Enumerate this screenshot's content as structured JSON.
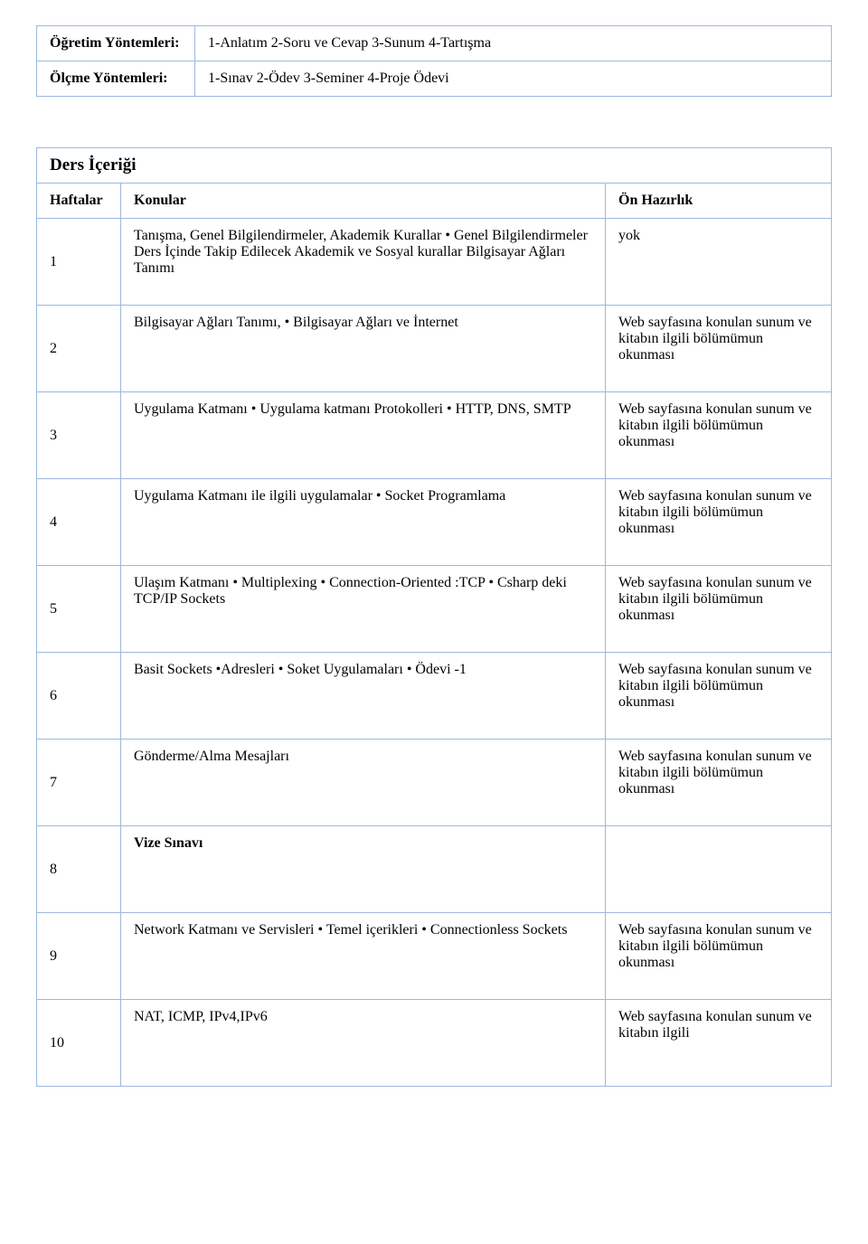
{
  "methods": {
    "teaching_label": "Öğretim Yöntemleri:",
    "teaching_value": "1-Anlatım   2-Soru ve Cevap  3-Sunum  4-Tartışma",
    "assessment_label": "Ölçme Yöntemleri:",
    "assessment_value": "1-Sınav   2-Ödev   3-Seminer   4-Proje Ödevi"
  },
  "content_title": "Ders İçeriği",
  "schedule_header": {
    "weeks": "Haftalar",
    "topics": "Konular",
    "prep": "Ön Hazırlık"
  },
  "rows": [
    {
      "week": "1",
      "topic": "Tanışma, Genel Bilgilendirmeler, Akademik Kurallar • Genel Bilgilendirmeler Ders İçinde Takip Edilecek Akademik ve Sosyal kurallar Bilgisayar Ağları Tanımı",
      "prep": "yok"
    },
    {
      "week": "2",
      "topic": "Bilgisayar Ağları Tanımı, • Bilgisayar Ağları ve İnternet",
      "prep": "Web sayfasına konulan sunum ve kitabın ilgili bölümümun okunması"
    },
    {
      "week": "3",
      "topic": "Uygulama Katmanı • Uygulama katmanı Protokolleri • HTTP, DNS, SMTP",
      "prep": "Web sayfasına konulan sunum ve kitabın ilgili bölümümun okunması"
    },
    {
      "week": "4",
      "topic": "Uygulama Katmanı ile ilgili uygulamalar • Socket Programlama",
      "prep": "Web sayfasına konulan sunum ve kitabın ilgili bölümümun okunması"
    },
    {
      "week": "5",
      "topic": "Ulaşım Katmanı • Multiplexing • Connection-Oriented :TCP • Csharp deki TCP/IP Sockets",
      "prep": "Web sayfasına konulan sunum ve kitabın ilgili bölümümun okunması"
    },
    {
      "week": "6",
      "topic": "Basit Sockets •Adresleri • Soket Uygulamaları • Ödevi -1",
      "prep": "Web sayfasına konulan sunum ve kitabın ilgili bölümümun okunması"
    },
    {
      "week": "7",
      "topic": "Gönderme/Alma Mesajları",
      "prep": "Web sayfasına konulan sunum ve kitabın ilgili bölümümun okunması"
    },
    {
      "week": "8",
      "topic": "Vize Sınavı",
      "prep": "",
      "bold": true
    },
    {
      "week": "9",
      "topic": "Network Katmanı ve Servisleri • Temel içerikleri • Connectionless Sockets",
      "prep": "Web sayfasına konulan sunum ve kitabın ilgili bölümümun okunması"
    },
    {
      "week": "10",
      "topic": "NAT, ICMP, IPv4,IPv6",
      "prep": "Web sayfasına konulan sunum ve kitabın ilgili"
    }
  ]
}
